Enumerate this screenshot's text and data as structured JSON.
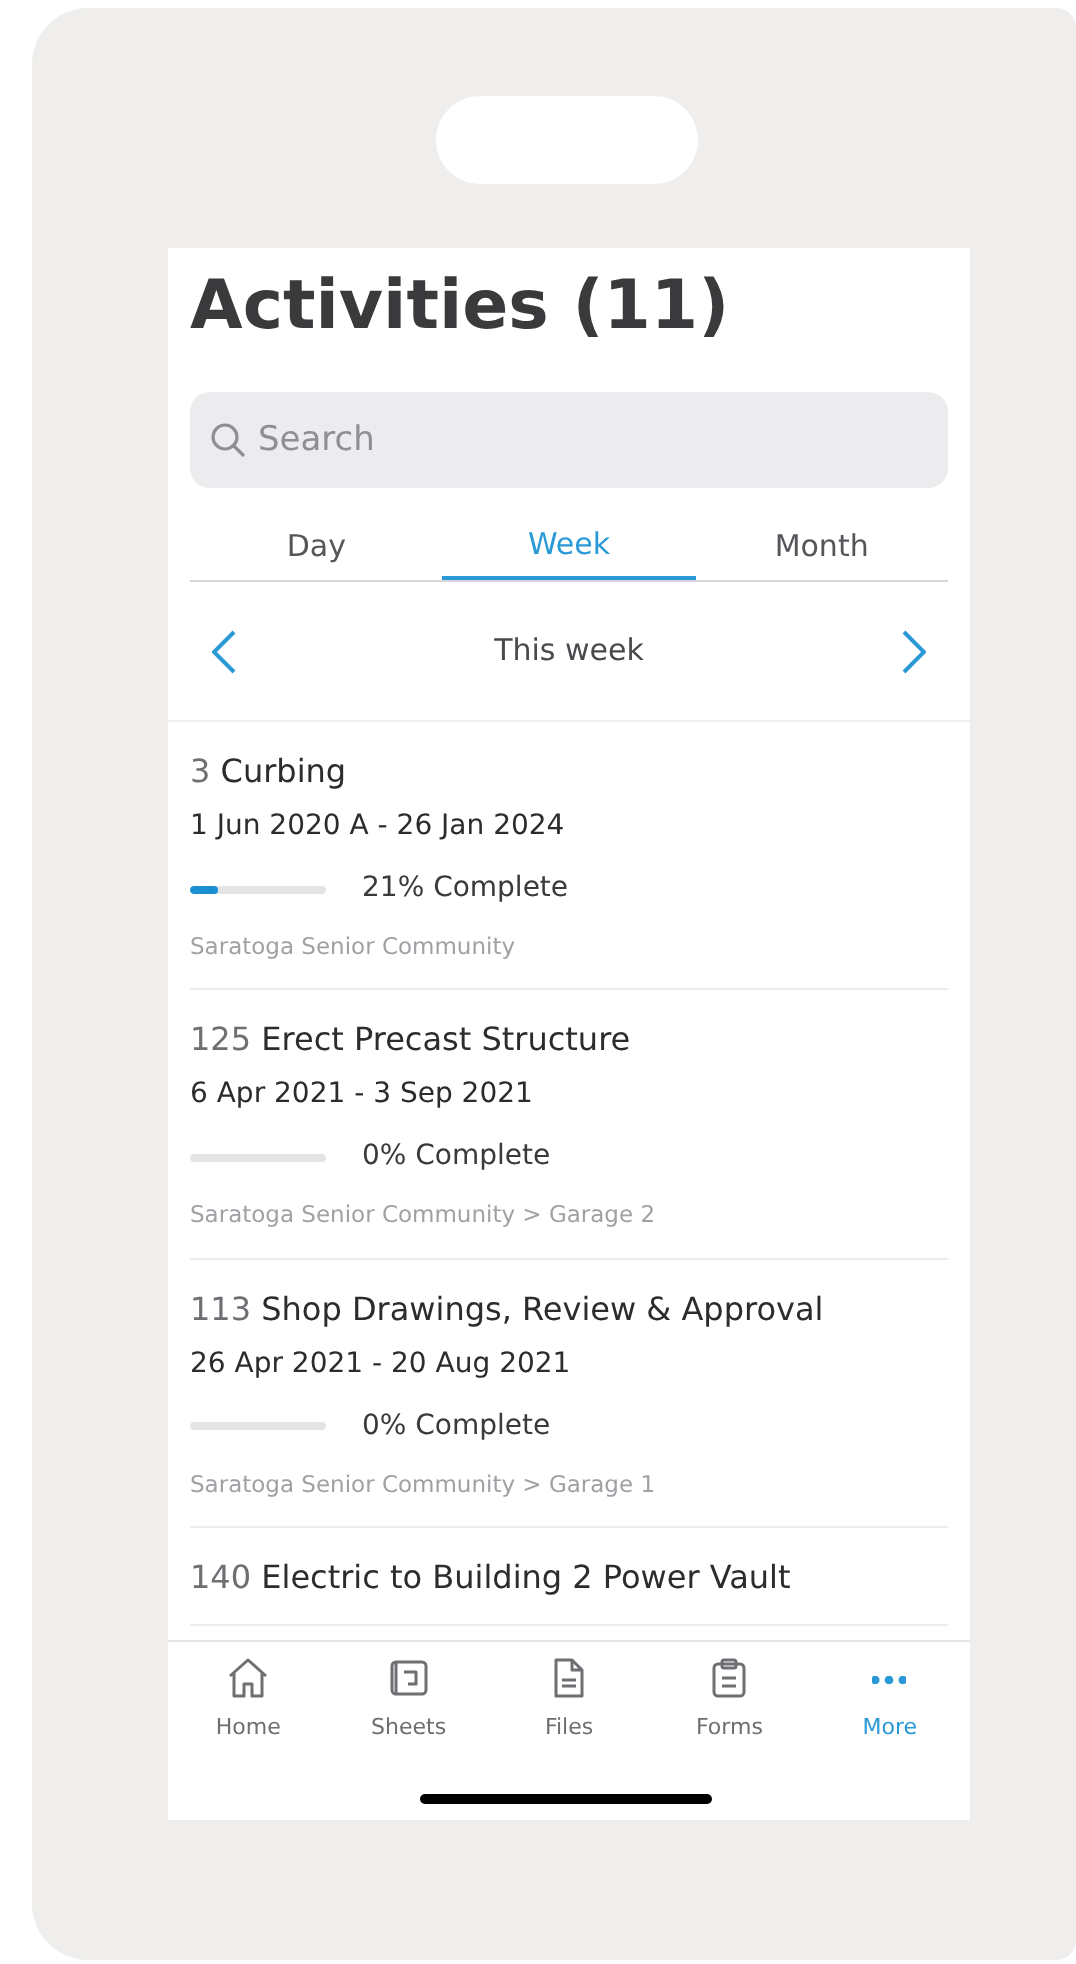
{
  "title": "Activities (11)",
  "search": {
    "placeholder": "Search"
  },
  "tabs": [
    {
      "label": "Day",
      "selected": false
    },
    {
      "label": "Week",
      "selected": true
    },
    {
      "label": "Month",
      "selected": false
    }
  ],
  "period": {
    "label": "This week"
  },
  "activities": [
    {
      "number": "3",
      "name": "Curbing",
      "dates": "1 Jun 2020 A - 26 Jan 2024",
      "level": 0.21,
      "progress": "21% Complete",
      "path": "Saratoga Senior Community"
    },
    {
      "number": "125",
      "name": "Erect Precast Structure",
      "dates": "6 Apr 2021 - 3 Sep 2021",
      "level": 0,
      "progress": "0% Complete",
      "path": "Saratoga Senior Community > Garage 2"
    },
    {
      "number": "113",
      "name": "Shop Drawings, Review & Approval",
      "dates": "26 Apr 2021 - 20 Aug 2021",
      "level": 0,
      "progress": "0% Complete",
      "path": "Saratoga Senior Community > Garage 1"
    },
    {
      "number": "140",
      "name": "Electric to Building 2 Power Vault"
    }
  ],
  "tab_bar": [
    {
      "kind": "home",
      "label": "Home",
      "selected": false
    },
    {
      "kind": "sheets",
      "label": "Sheets",
      "selected": false
    },
    {
      "kind": "files",
      "label": "Files",
      "selected": false
    },
    {
      "kind": "forms",
      "label": "Forms",
      "selected": false
    },
    {
      "kind": "more",
      "label": "More",
      "selected": true
    }
  ]
}
